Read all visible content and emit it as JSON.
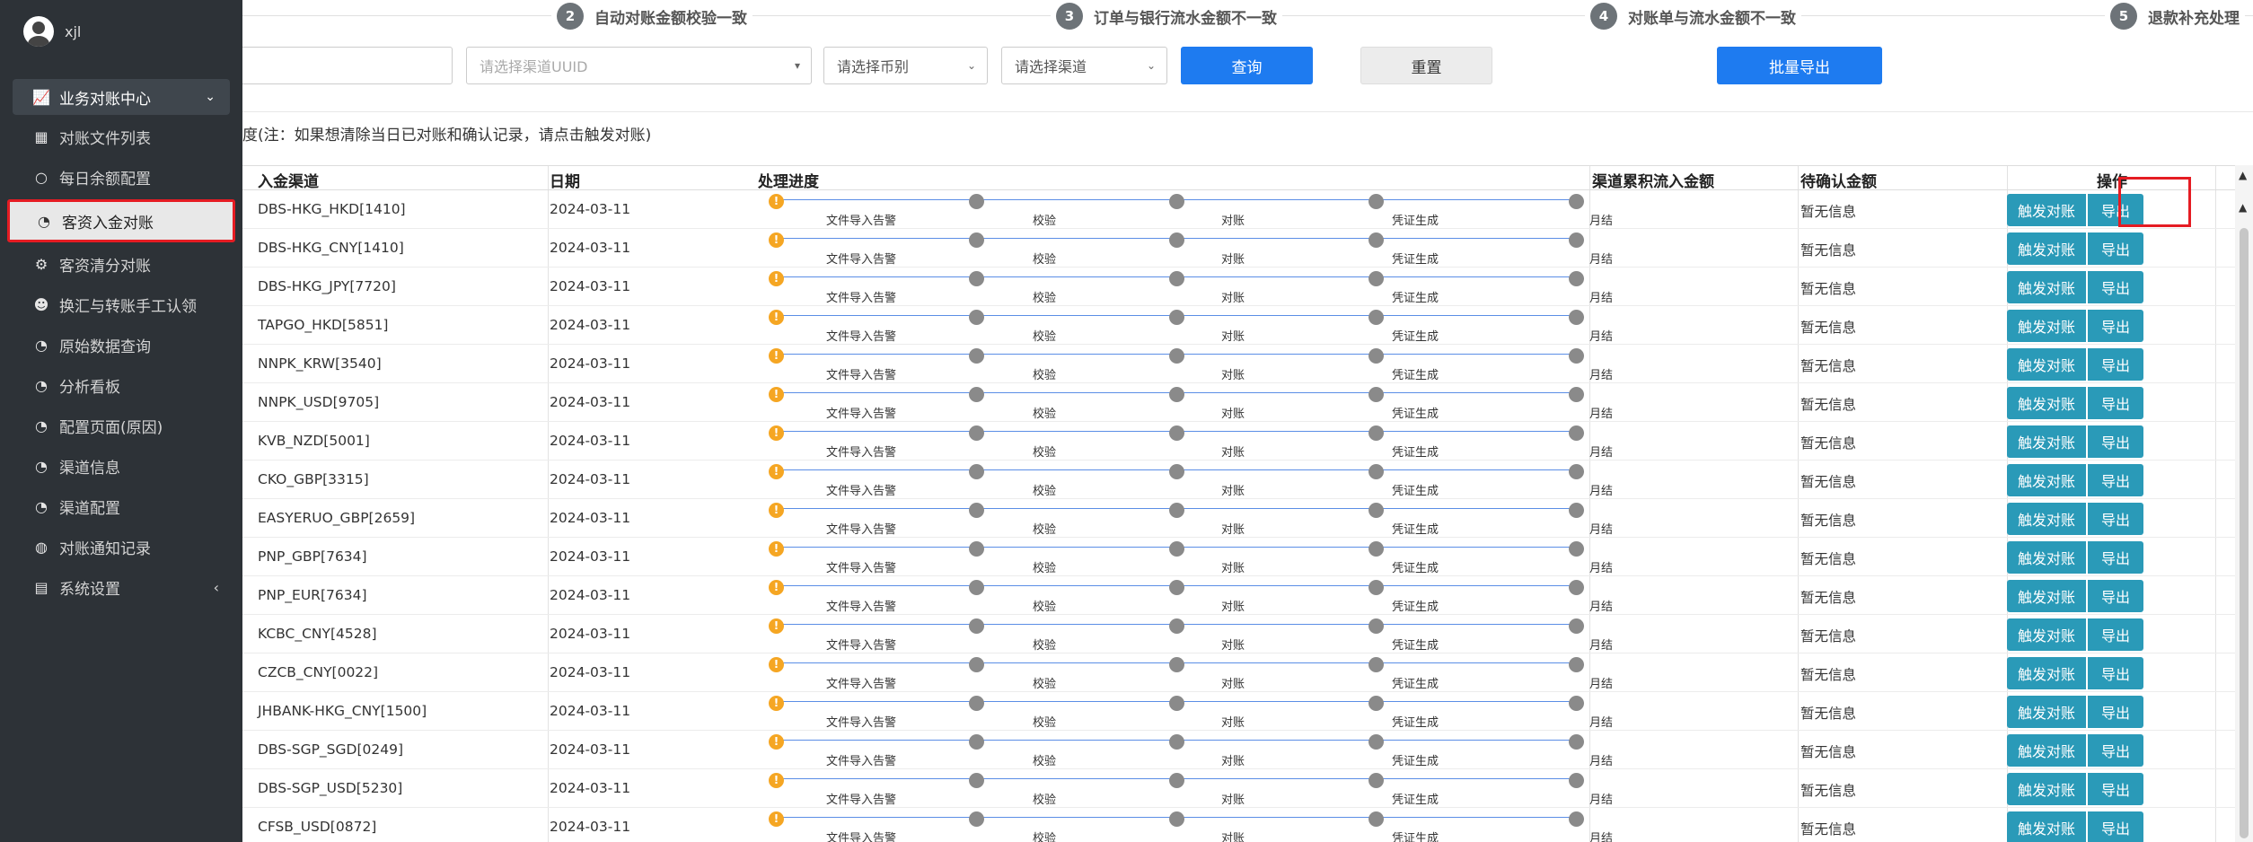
{
  "sidebar": {
    "username": "xjl",
    "items": [
      {
        "label": "业务对账中心",
        "icon": "chart-line-icon",
        "glyph": "📈"
      },
      {
        "label": "对账文件列表",
        "icon": "table-icon",
        "glyph": "▦"
      },
      {
        "label": "每日余额配置",
        "icon": "circle-icon",
        "glyph": "○"
      },
      {
        "label": "客资入金对账",
        "icon": "dashboard-icon",
        "glyph": "◔"
      },
      {
        "label": "客资清分对账",
        "icon": "gear-icon",
        "glyph": "⚙"
      },
      {
        "label": "换汇与转账手工认领",
        "icon": "smile-icon",
        "glyph": "☻"
      },
      {
        "label": "原始数据查询",
        "icon": "dashboard-icon",
        "glyph": "◔"
      },
      {
        "label": "分析看板",
        "icon": "dashboard-icon",
        "glyph": "◔"
      },
      {
        "label": "配置页面(原因)",
        "icon": "dashboard-icon",
        "glyph": "◔"
      },
      {
        "label": "渠道信息",
        "icon": "dashboard-icon",
        "glyph": "◔"
      },
      {
        "label": "渠道配置",
        "icon": "dashboard-icon",
        "glyph": "◔"
      },
      {
        "label": "对账通知记录",
        "icon": "globe-icon",
        "glyph": "🌐"
      },
      {
        "label": "系统设置",
        "icon": "calendar-icon",
        "glyph": "▤"
      }
    ]
  },
  "steps": [
    {
      "num": "2",
      "label": "自动对账金额校验一致"
    },
    {
      "num": "3",
      "label": "订单与银行流水金额不一致"
    },
    {
      "num": "4",
      "label": "对账单与流水金额不一致"
    },
    {
      "num": "5",
      "label": "退款补充处理"
    }
  ],
  "filters": {
    "uuid_placeholder": "请选择渠道UUID",
    "currency_placeholder": "请选择币别",
    "channel_placeholder": "请选择渠道",
    "query": "查询",
    "reset": "重置",
    "batch_export": "批量导出"
  },
  "note": "度(注：如果想清除当日已对账和确认记录，请点击触发对账)",
  "columns": {
    "channel": "入金渠道",
    "date": "日期",
    "progress": "处理进度",
    "inflow": "渠道累积流入金额",
    "pending": "待确认金额",
    "ops": "操作"
  },
  "progress_steps": [
    "文件导入告警",
    "校验",
    "对账",
    "凭证生成",
    "月结"
  ],
  "row_actions": {
    "trigger": "触发对账",
    "export": "导出"
  },
  "rows": [
    {
      "channel": "DBS-HKG_HKD[1410]",
      "date": "2024-03-11",
      "pending": "暂无信息"
    },
    {
      "channel": "DBS-HKG_CNY[1410]",
      "date": "2024-03-11",
      "pending": "暂无信息"
    },
    {
      "channel": "DBS-HKG_JPY[7720]",
      "date": "2024-03-11",
      "pending": "暂无信息"
    },
    {
      "channel": "TAPGO_HKD[5851]",
      "date": "2024-03-11",
      "pending": "暂无信息"
    },
    {
      "channel": "NNPK_KRW[3540]",
      "date": "2024-03-11",
      "pending": "暂无信息"
    },
    {
      "channel": "NNPK_USD[9705]",
      "date": "2024-03-11",
      "pending": "暂无信息"
    },
    {
      "channel": "KVB_NZD[5001]",
      "date": "2024-03-11",
      "pending": "暂无信息"
    },
    {
      "channel": "CKO_GBP[3315]",
      "date": "2024-03-11",
      "pending": "暂无信息"
    },
    {
      "channel": "EASYERUO_GBP[2659]",
      "date": "2024-03-11",
      "pending": "暂无信息"
    },
    {
      "channel": "PNP_GBP[7634]",
      "date": "2024-03-11",
      "pending": "暂无信息"
    },
    {
      "channel": "PNP_EUR[7634]",
      "date": "2024-03-11",
      "pending": "暂无信息"
    },
    {
      "channel": "KCBC_CNY[4528]",
      "date": "2024-03-11",
      "pending": "暂无信息"
    },
    {
      "channel": "CZCB_CNY[0022]",
      "date": "2024-03-11",
      "pending": "暂无信息"
    },
    {
      "channel": "JHBANK-HKG_CNY[1500]",
      "date": "2024-03-11",
      "pending": "暂无信息"
    },
    {
      "channel": "DBS-SGP_SGD[0249]",
      "date": "2024-03-11",
      "pending": "暂无信息"
    },
    {
      "channel": "DBS-SGP_USD[5230]",
      "date": "2024-03-11",
      "pending": "暂无信息"
    },
    {
      "channel": "CFSB_USD[0872]",
      "date": "2024-03-11",
      "pending": "暂无信息"
    }
  ]
}
